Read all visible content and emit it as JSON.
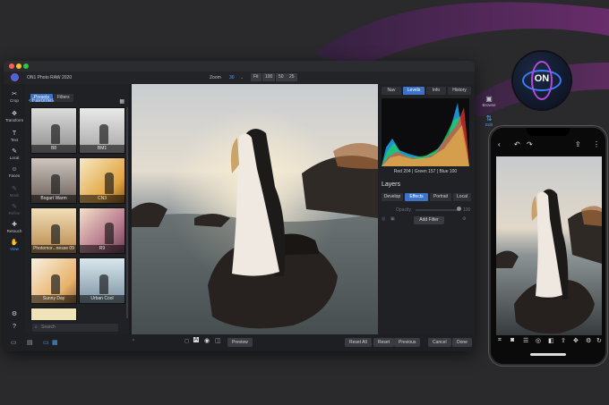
{
  "window": {
    "app_name": "ON1 Photo RAW 2020",
    "zoom_label": "Zoom",
    "zoom_value": "30",
    "zoom_buttons": [
      "Fit",
      "100",
      "50",
      "25"
    ]
  },
  "left_tools": [
    {
      "label": "Crop",
      "icon": "crop-icon",
      "glyph": "✂",
      "state": "normal"
    },
    {
      "label": "Transform",
      "icon": "move-icon",
      "glyph": "✥",
      "state": "normal"
    },
    {
      "label": "Text",
      "icon": "text-icon",
      "glyph": "T",
      "state": "normal"
    },
    {
      "label": "Local",
      "icon": "brush-icon",
      "glyph": "✎",
      "state": "normal"
    },
    {
      "label": "Faces",
      "icon": "faces-icon",
      "glyph": "☺",
      "state": "normal"
    },
    {
      "label": "Mask",
      "icon": "mask-icon",
      "glyph": "✎",
      "state": "dim"
    },
    {
      "label": "Refine",
      "icon": "refine-icon",
      "glyph": "✎",
      "state": "dim"
    },
    {
      "label": "Retouch",
      "icon": "retouch-icon",
      "glyph": "✚",
      "state": "normal"
    },
    {
      "label": "View",
      "icon": "hand-icon",
      "glyph": "✋",
      "state": "active"
    }
  ],
  "presets": {
    "tabs": [
      "Presets",
      "Filters"
    ],
    "active_tab": "Presets",
    "folder": "Favorites",
    "items": [
      {
        "name": "B8"
      },
      {
        "name": "BM1"
      },
      {
        "name": "Bogart Warm"
      },
      {
        "name": "CN3"
      },
      {
        "name": "Photomor...nesse 09"
      },
      {
        "name": "R9"
      },
      {
        "name": "Sunny Day"
      },
      {
        "name": "Urban Cool"
      }
    ],
    "search_placeholder": "Search"
  },
  "bottom_bar": {
    "preview": "Preview",
    "reset_all": "Reset All",
    "reset": "Reset",
    "previous": "Previous",
    "cancel": "Cancel",
    "done": "Done"
  },
  "right_panel": {
    "tabs": [
      "Nav",
      "Levels",
      "Info",
      "History"
    ],
    "active_tab": "Levels",
    "rgb_readout": "Red 204 | Green 157 | Blue 100",
    "layers_title": "Layers",
    "edit_tabs": [
      "Develop",
      "Effects",
      "Portrait",
      "Local"
    ],
    "active_edit_tab": "Effects",
    "opacity_label": "Opacity",
    "opacity_value": "100",
    "add_filter": "Add Filter"
  },
  "far_right": [
    {
      "label": "Browse",
      "icon": "browse-icon"
    },
    {
      "label": "Edit",
      "icon": "edit-icon"
    }
  ],
  "colors": {
    "accent": "#3d74c9",
    "active_tool": "#4aa3ff",
    "window_bg": "#1b1c1f",
    "panel_bg": "#202125"
  }
}
